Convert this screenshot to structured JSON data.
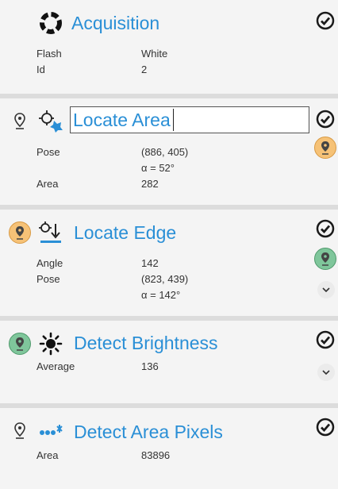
{
  "steps": [
    {
      "title": "Acquisition",
      "properties": [
        {
          "key": "Flash",
          "value": "White"
        },
        {
          "key": "Id",
          "value": "2"
        }
      ],
      "tool_icon": "ring-camera-icon",
      "status": "ok"
    },
    {
      "title": "Locate Area",
      "editing": true,
      "properties": [
        {
          "key": "Pose",
          "value": "(886, 405)"
        },
        {
          "key": "",
          "value": "α = 52°"
        },
        {
          "key": "Area",
          "value": "282"
        }
      ],
      "tool_icon": "locate-area-icon",
      "status": "ok"
    },
    {
      "title": "Locate Edge",
      "properties": [
        {
          "key": "Angle",
          "value": "142"
        },
        {
          "key": "Pose",
          "value": "(823, 439)"
        },
        {
          "key": "",
          "value": "α = 142°"
        }
      ],
      "tool_icon": "locate-edge-icon",
      "status": "ok"
    },
    {
      "title": "Detect Brightness",
      "properties": [
        {
          "key": "Average",
          "value": "136"
        }
      ],
      "tool_icon": "brightness-icon",
      "status": "ok"
    },
    {
      "title": "Detect Area Pixels",
      "properties": [
        {
          "key": "Area",
          "value": "83896"
        }
      ],
      "tool_icon": "area-pixels-icon",
      "status": "ok"
    }
  ],
  "colors": {
    "title": "#2a8fd6",
    "pin_orange": "#f6c277",
    "pin_green": "#7fc69b",
    "check": "#1a1a1a"
  }
}
